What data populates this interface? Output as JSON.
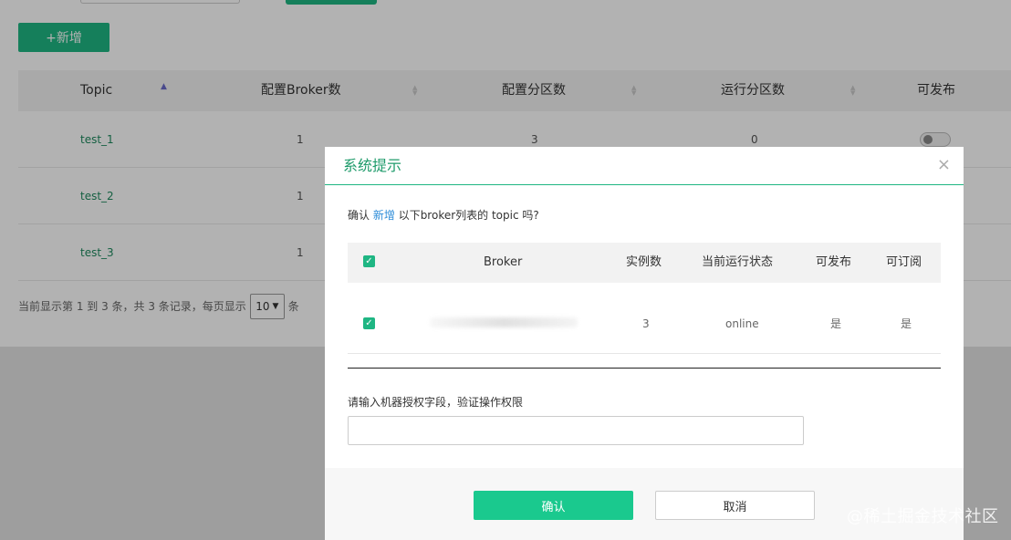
{
  "toolbar": {
    "add_label": "+新增"
  },
  "table": {
    "columns": [
      "Topic",
      "配置Broker数",
      "配置分区数",
      "运行分区数",
      "可发布"
    ],
    "rows": [
      {
        "topic": "test_1",
        "brokers": "1",
        "partitions": "3",
        "running": "0"
      },
      {
        "topic": "test_2",
        "brokers": "1"
      },
      {
        "topic": "test_3",
        "brokers": "1"
      }
    ]
  },
  "pager": {
    "prefix": "当前显示第 1 到 3 条，共 3 条记录，每页显示",
    "page_size": "10",
    "suffix": "条"
  },
  "modal": {
    "title": "系统提示",
    "close_glyph": "×",
    "confirm_prefix": "确认",
    "confirm_action": "新增",
    "confirm_suffix": "以下broker列表的 topic 吗?",
    "columns": [
      "Broker",
      "实例数",
      "当前运行状态",
      "可发布",
      "可订阅"
    ],
    "rows": [
      {
        "instances": "3",
        "status": "online",
        "publish": "是",
        "subscribe": "是"
      }
    ],
    "auth_label": "请输入机器授权字段，验证操作权限",
    "auth_value": "",
    "ok_label": "确认",
    "cancel_label": "取消"
  },
  "watermark": "@稀土掘金技术社区",
  "colors": {
    "accent": "#1fb683",
    "confirm_button": "#1ac98e",
    "link": "#2d8cd8"
  }
}
